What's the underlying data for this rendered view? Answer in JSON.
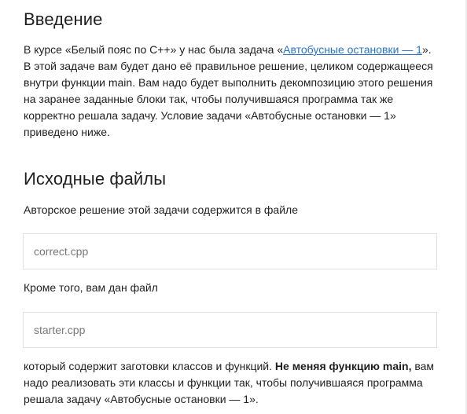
{
  "intro": {
    "heading": "Введение",
    "text_before_link": "В курсе «Белый пояс по C++» у нас была задача «",
    "link_text": "Автобусные остановки — 1",
    "text_after_link": "». В этой задаче вам будет дано её правильное решение, целиком содержащееся внутри функции ",
    "code_main": "main",
    "text_end": ". Вам надо будет выполнить декомпозицию этого решения на заранее заданные блоки так, чтобы получившаяся программа так же корректно решала задачу. Условие задачи «Автобусные остановки — 1» приведено ниже."
  },
  "source_files": {
    "heading": "Исходные файлы",
    "author_solution_text": "Авторское решение этой задачи содержится в файле",
    "file_correct": "correct.cpp",
    "also_text": "Кроме того, вам дан файл",
    "file_starter": "starter.cpp",
    "tail_text_before_bold": "который содержит заготовки классов и функций. ",
    "tail_bold": "Не меняя функцию main,",
    "tail_text_after_bold": " вам надо реализовать эти классы и функции так, чтобы получившаяся программа решала задачу «Автобусные остановки — 1»."
  },
  "colors": {
    "link": "#2a73cc",
    "text": "#1f1f1f",
    "muted": "#777777",
    "border": "#e2e2e2"
  }
}
